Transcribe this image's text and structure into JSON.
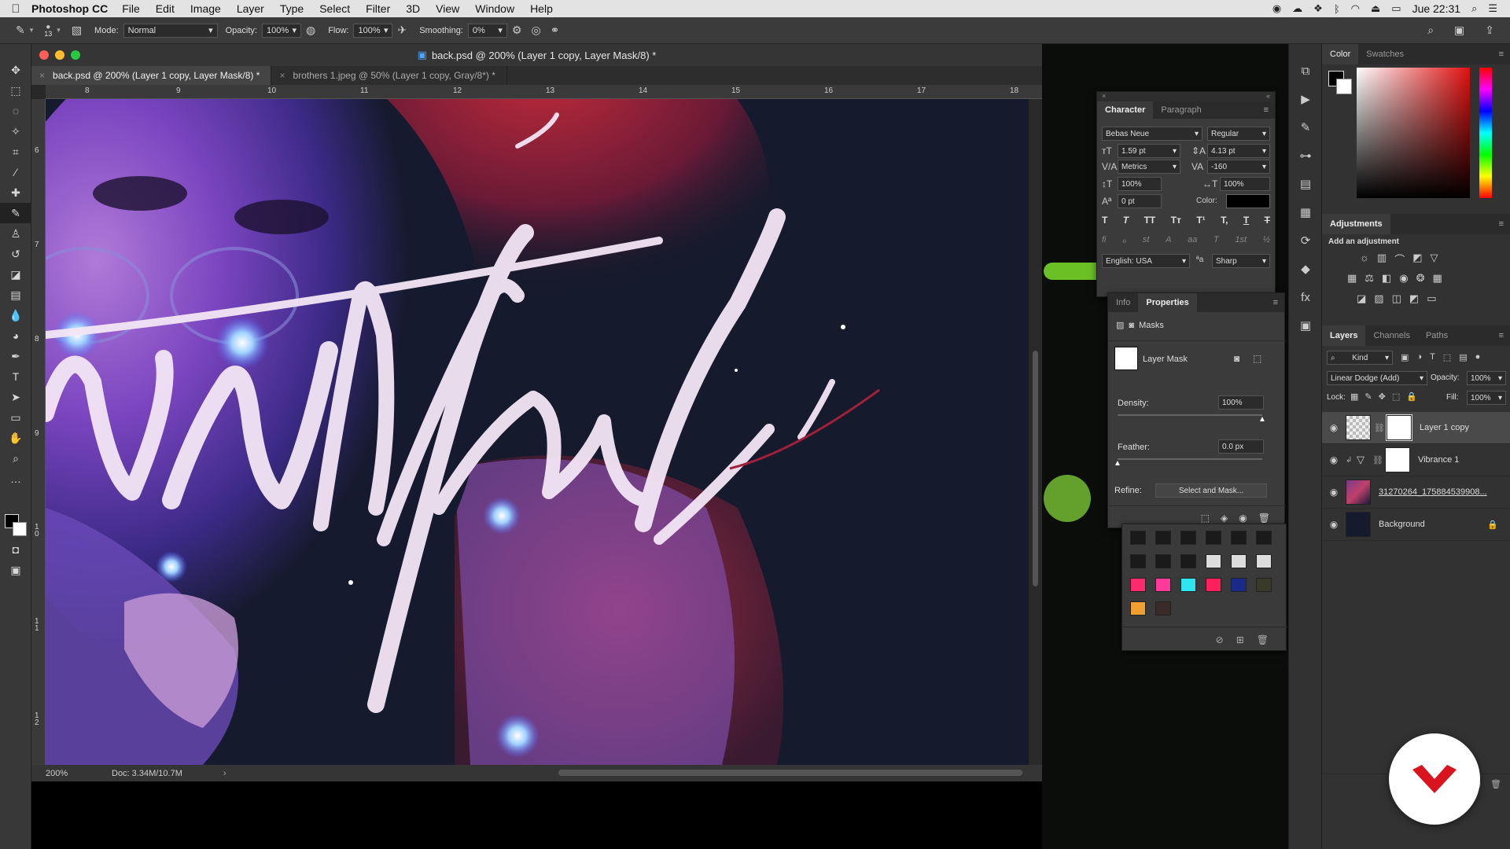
{
  "menubar": {
    "app": "Photoshop CC",
    "menus": [
      "File",
      "Edit",
      "Image",
      "Layer",
      "Type",
      "Select",
      "Filter",
      "3D",
      "View",
      "Window",
      "Help"
    ],
    "clock": "Jue 22:31"
  },
  "options": {
    "brush_size": "13",
    "mode_label": "Mode:",
    "mode_value": "Normal",
    "opacity_label": "Opacity:",
    "opacity_value": "100%",
    "flow_label": "Flow:",
    "flow_value": "100%",
    "smoothing_label": "Smoothing:",
    "smoothing_value": "0%"
  },
  "document": {
    "title": "back.psd @ 200% (Layer 1 copy, Layer Mask/8) *",
    "tabs": [
      {
        "label": "back.psd @ 200% (Layer 1 copy, Layer Mask/8) *",
        "active": true
      },
      {
        "label": "brothers 1.jpeg @ 50% (Layer 1 copy, Gray/8*) *",
        "active": false
      }
    ],
    "ruler_top": [
      "8",
      "9",
      "10",
      "11",
      "12",
      "13",
      "14",
      "15",
      "16",
      "17",
      "18"
    ],
    "ruler_left": [
      "6",
      "7",
      "8",
      "9",
      "1\n0",
      "1\n1",
      "1\n2"
    ],
    "zoom": "200%",
    "doc_size": "Doc: 3.34M/10.7M"
  },
  "character": {
    "tabs": [
      "Character",
      "Paragraph"
    ],
    "font_family": "Bebas Neue",
    "font_style": "Regular",
    "size": "1.59 pt",
    "leading": "4.13 pt",
    "kerning": "Metrics",
    "tracking": "-160",
    "vscale": "100%",
    "hscale": "100%",
    "baseline": "0 pt",
    "color_label": "Color:",
    "language": "English: USA",
    "antialias": "Sharp",
    "style_buttons": [
      "T",
      "T",
      "TT",
      "Tт",
      "T¹",
      "T,",
      "T",
      "T"
    ],
    "ot_buttons": [
      "fi",
      "ℴ",
      "st",
      "A",
      "aa",
      "T",
      "1st",
      "½"
    ]
  },
  "properties": {
    "tabs": [
      "Info",
      "Properties"
    ],
    "section": "Masks",
    "mask_name": "Layer Mask",
    "density_label": "Density:",
    "density_value": "100%",
    "density_level": 1.0,
    "feather_label": "Feather:",
    "feather_value": "0.0 px",
    "feather_level": 0.0,
    "refine_label": "Refine:",
    "refine_button": "Select and Mask..."
  },
  "swatches_colors": [
    "#1a1a1a",
    "#1a1a1a",
    "#1a1a1a",
    "#1a1a1a",
    "#1a1a1a",
    "#1a1a1a",
    "#1a1a1a",
    "#1a1a1a",
    "#1a1a1a",
    "#dddddd",
    "#dddddd",
    "#dddddd",
    "#ff2a6d",
    "#ff3a9a",
    "#2ee6f0",
    "#ff1f5a",
    "#1a2a88",
    "#3a3a2a",
    "#f0a030",
    "#3a2a2a"
  ],
  "color_panel": {
    "tabs": [
      "Color",
      "Swatches"
    ]
  },
  "adjustments": {
    "title": "Adjustments",
    "subtitle": "Add an adjustment"
  },
  "layers": {
    "tabs": [
      "Layers",
      "Channels",
      "Paths"
    ],
    "kind": "Kind",
    "blend_mode": "Linear Dodge (Add)",
    "opacity_label": "Opacity:",
    "opacity_value": "100%",
    "lock_label": "Lock:",
    "fill_label": "Fill:",
    "fill_value": "100%",
    "items": [
      {
        "name": "Layer 1 copy",
        "active": true
      },
      {
        "name": "Vibrance 1",
        "active": false
      },
      {
        "name": "31270264_175884539908...",
        "active": false
      },
      {
        "name": "Background",
        "active": false
      }
    ]
  },
  "colors": {
    "accent_red": "#d9141f",
    "panel_bg": "#3b3b3b"
  }
}
